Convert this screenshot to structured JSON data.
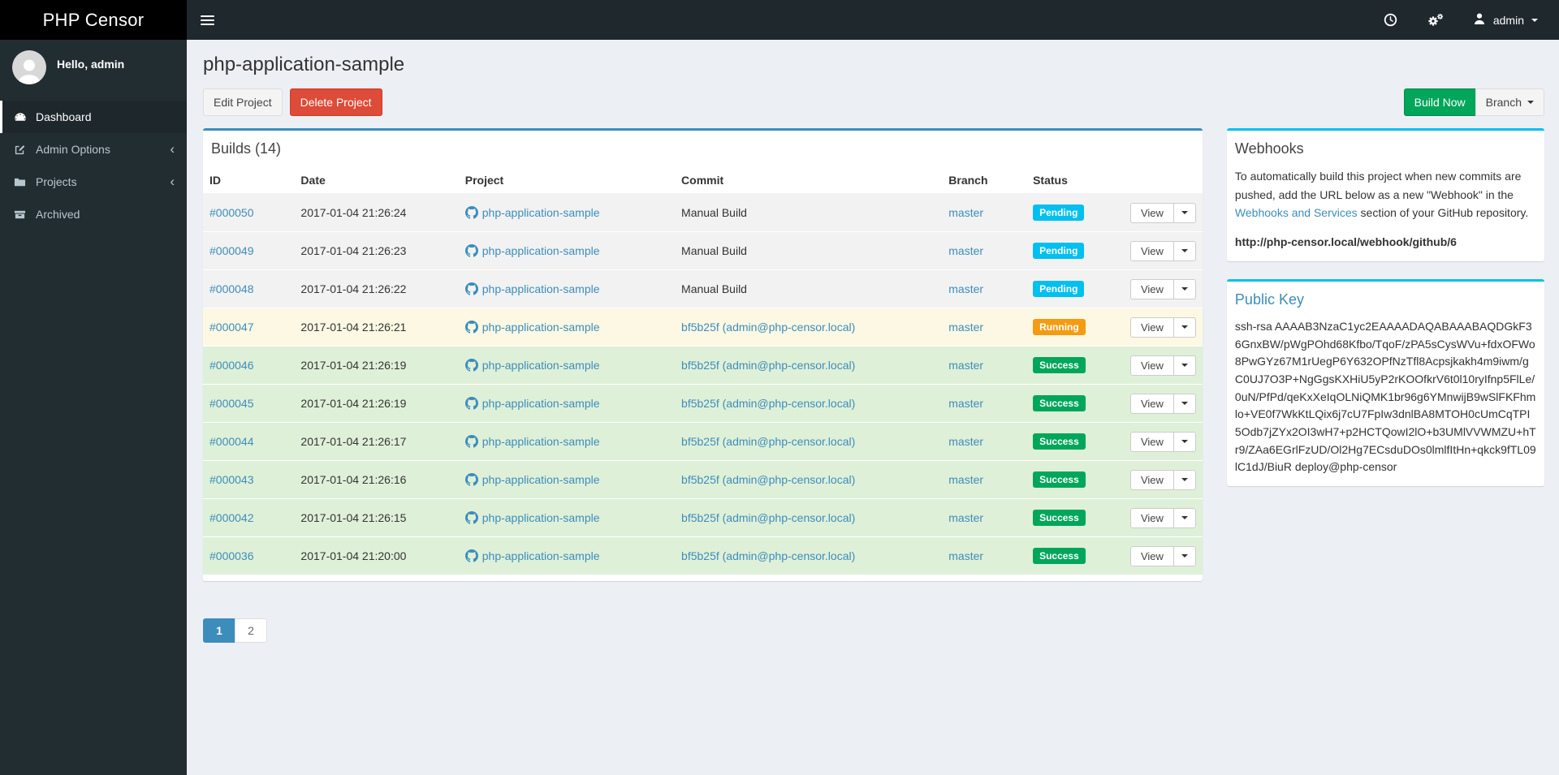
{
  "brand": {
    "title": "PHP Censor"
  },
  "navbar": {
    "user_label": "admin"
  },
  "sidebar": {
    "greeting": "Hello, admin",
    "items": [
      {
        "label": "Dashboard",
        "icon": "tachometer-icon",
        "active": true
      },
      {
        "label": "Admin Options",
        "icon": "edit-icon",
        "has_submenu": true
      },
      {
        "label": "Projects",
        "icon": "folder-icon",
        "has_submenu": true
      },
      {
        "label": "Archived",
        "icon": "archive-icon"
      }
    ]
  },
  "page": {
    "title": "php-application-sample",
    "edit_button": "Edit Project",
    "delete_button": "Delete Project",
    "build_now_button": "Build Now",
    "branch_button": "Branch"
  },
  "builds_panel": {
    "title": "Builds (14)",
    "columns": [
      "ID",
      "Date",
      "Project",
      "Commit",
      "Branch",
      "Status",
      ""
    ],
    "view_label": "View",
    "rows": [
      {
        "id": "#000050",
        "date": "2017-01-04 21:26:24",
        "project": "php-application-sample",
        "commit": "Manual Build",
        "commit_is_link": false,
        "branch": "master",
        "status": "Pending"
      },
      {
        "id": "#000049",
        "date": "2017-01-04 21:26:23",
        "project": "php-application-sample",
        "commit": "Manual Build",
        "commit_is_link": false,
        "branch": "master",
        "status": "Pending"
      },
      {
        "id": "#000048",
        "date": "2017-01-04 21:26:22",
        "project": "php-application-sample",
        "commit": "Manual Build",
        "commit_is_link": false,
        "branch": "master",
        "status": "Pending"
      },
      {
        "id": "#000047",
        "date": "2017-01-04 21:26:21",
        "project": "php-application-sample",
        "commit": "bf5b25f (admin@php-censor.local)",
        "commit_is_link": true,
        "branch": "master",
        "status": "Running"
      },
      {
        "id": "#000046",
        "date": "2017-01-04 21:26:19",
        "project": "php-application-sample",
        "commit": "bf5b25f (admin@php-censor.local)",
        "commit_is_link": true,
        "branch": "master",
        "status": "Success"
      },
      {
        "id": "#000045",
        "date": "2017-01-04 21:26:19",
        "project": "php-application-sample",
        "commit": "bf5b25f (admin@php-censor.local)",
        "commit_is_link": true,
        "branch": "master",
        "status": "Success"
      },
      {
        "id": "#000044",
        "date": "2017-01-04 21:26:17",
        "project": "php-application-sample",
        "commit": "bf5b25f (admin@php-censor.local)",
        "commit_is_link": true,
        "branch": "master",
        "status": "Success"
      },
      {
        "id": "#000043",
        "date": "2017-01-04 21:26:16",
        "project": "php-application-sample",
        "commit": "bf5b25f (admin@php-censor.local)",
        "commit_is_link": true,
        "branch": "master",
        "status": "Success"
      },
      {
        "id": "#000042",
        "date": "2017-01-04 21:26:15",
        "project": "php-application-sample",
        "commit": "bf5b25f (admin@php-censor.local)",
        "commit_is_link": true,
        "branch": "master",
        "status": "Success"
      },
      {
        "id": "#000036",
        "date": "2017-01-04 21:20:00",
        "project": "php-application-sample",
        "commit": "bf5b25f (admin@php-censor.local)",
        "commit_is_link": true,
        "branch": "master",
        "status": "Success"
      }
    ]
  },
  "status_badge_colors": {
    "Pending": "#00c0ef",
    "Running": "#f39c12",
    "Success": "#00a65a"
  },
  "status_row_colors": {
    "Pending": "#f2f2f2",
    "Running": "#fcf8e3",
    "Success": "#dff0d8"
  },
  "pagination": {
    "pages": [
      "1",
      "2"
    ],
    "active_page": "1"
  },
  "webhooks_panel": {
    "title": "Webhooks",
    "text_before_link": "To automatically build this project when new commits are pushed, add the URL below as a new \"Webhook\" in the ",
    "link_text": "Webhooks and Services",
    "text_after_link": " section of your GitHub repository.",
    "webhook_url": "http://php-censor.local/webhook/github/6"
  },
  "public_key_panel": {
    "title": "Public Key",
    "key": "ssh-rsa AAAAB3NzaC1yc2EAAAADAQABAAABAQDGkF36GnxBW/pWgPOhd68Kfbo/TqoF/zPA5sCysWVu+fdxOFWo8PwGYz67M1rUegP6Y632OPfNzTfl8Acpsjkakh4m9iwm/gC0UJ7O3P+NgGgsKXHiU5yP2rKOOfkrV6t0l10ryIfnp5FlLe/0uN/PfPd/qeKxXeIqOLNiQMK1br96g6YMnwijB9wSlFKFhmlo+VE0f7WkKtLQix6j7cU7FpIw3dnlBA8MTOH0cUmCqTPI5Odb7jZYx2OI3wH7+p2HCTQowI2lO+b3UMlVVWMZU+hTr9/ZAa6EGrlFzUD/Ol2Hg7ECsduDOs0lmlfItHn+qkck9fTL09lC1dJ/BiuR deploy@php-censor"
  },
  "theme_colors": {
    "primary": "#3c8dbc",
    "info": "#00c0ef",
    "success": "#00a65a",
    "danger": "#dd4b39",
    "warning": "#f39c12",
    "sidebar_bg": "#222d32",
    "navbar_bg": "#1f282d",
    "body_bg": "#ecf0f5"
  }
}
